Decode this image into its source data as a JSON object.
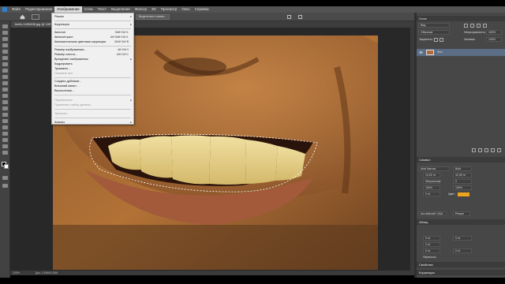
{
  "menubar": {
    "items": [
      "Файл",
      "Редактирование",
      "Изображение",
      "Слои",
      "Текст",
      "Выделение",
      "Фильтр",
      "3D",
      "Просмотр",
      "Окно",
      "Справка"
    ],
    "active_index": 2
  },
  "options": {
    "select_subject": "Выделение и маска..."
  },
  "tab": {
    "label": "teeth-1455498.jpg @ 100% (Слой 0, RGB/8)"
  },
  "status": {
    "zoom": "100%",
    "doc": "Док: 2,50M/3,33M"
  },
  "image_menu": {
    "items": [
      {
        "label": "Режим",
        "shortcut": "",
        "submenu": true,
        "disabled": false
      },
      {
        "label": "Коррекция",
        "shortcut": "",
        "submenu": true,
        "disabled": false
      },
      {
        "label": "Автотон",
        "shortcut": "Shift+Ctrl+L",
        "submenu": false,
        "disabled": false
      },
      {
        "label": "Автоконтраст",
        "shortcut": "Alt+Shift+Ctrl+L",
        "submenu": false,
        "disabled": false
      },
      {
        "label": "Автоматическая цветовая коррекция",
        "shortcut": "Shift+Ctrl+B",
        "submenu": false,
        "disabled": false
      },
      {
        "label": "Размер изображения...",
        "shortcut": "Alt+Ctrl+I",
        "submenu": false,
        "disabled": false
      },
      {
        "label": "Размер холста...",
        "shortcut": "Alt+Ctrl+C",
        "submenu": false,
        "disabled": false
      },
      {
        "label": "Вращение изображения",
        "shortcut": "",
        "submenu": true,
        "disabled": false
      },
      {
        "label": "Кадрировать",
        "shortcut": "",
        "submenu": false,
        "disabled": false
      },
      {
        "label": "Тримминг...",
        "shortcut": "",
        "submenu": false,
        "disabled": false
      },
      {
        "label": "Показать все",
        "shortcut": "",
        "submenu": false,
        "disabled": true
      },
      {
        "label": "Создать дубликат...",
        "shortcut": "",
        "submenu": false,
        "disabled": false
      },
      {
        "label": "Внешний канал...",
        "shortcut": "",
        "submenu": false,
        "disabled": false
      },
      {
        "label": "Вычисления...",
        "shortcut": "",
        "submenu": false,
        "disabled": false
      },
      {
        "label": "Переменные",
        "shortcut": "",
        "submenu": true,
        "disabled": true
      },
      {
        "label": "Применить набор данных...",
        "shortcut": "",
        "submenu": false,
        "disabled": true
      },
      {
        "label": "Треппинг...",
        "shortcut": "",
        "submenu": false,
        "disabled": true
      },
      {
        "label": "Анализ",
        "shortcut": "",
        "submenu": true,
        "disabled": false
      }
    ]
  },
  "layers": {
    "title": "Слои",
    "kind_placeholder": "Вид",
    "mode": "Обычные",
    "opacity_label": "Непрозрачность:",
    "opacity": "100%",
    "lock_label": "Закрепить:",
    "fill_label": "Заливка:",
    "fill": "100%",
    "layer_name": "Фон"
  },
  "character": {
    "title": "Символ",
    "font": "Arial Narrow",
    "style": "Bold",
    "size": "12,02 пт",
    "leading": "32,95 пт",
    "kerning": "Метрически",
    "tracking": "0",
    "vscale": "100%",
    "hscale": "100%",
    "baseline": "0 пт",
    "color_label": "Цвет:",
    "color": "#f0a31e",
    "lang": "Английский: США",
    "aa": "Резкое"
  },
  "paragraph": {
    "title": "Абзац",
    "indent_left": "0 пт",
    "indent_right": "0 пт",
    "indent_first": "0 пт",
    "space_before": "0 пт",
    "space_after": "0 пт",
    "hyphenate": "Переносы"
  },
  "properties": {
    "title": "Свойства",
    "adjustments": "Коррекция"
  }
}
